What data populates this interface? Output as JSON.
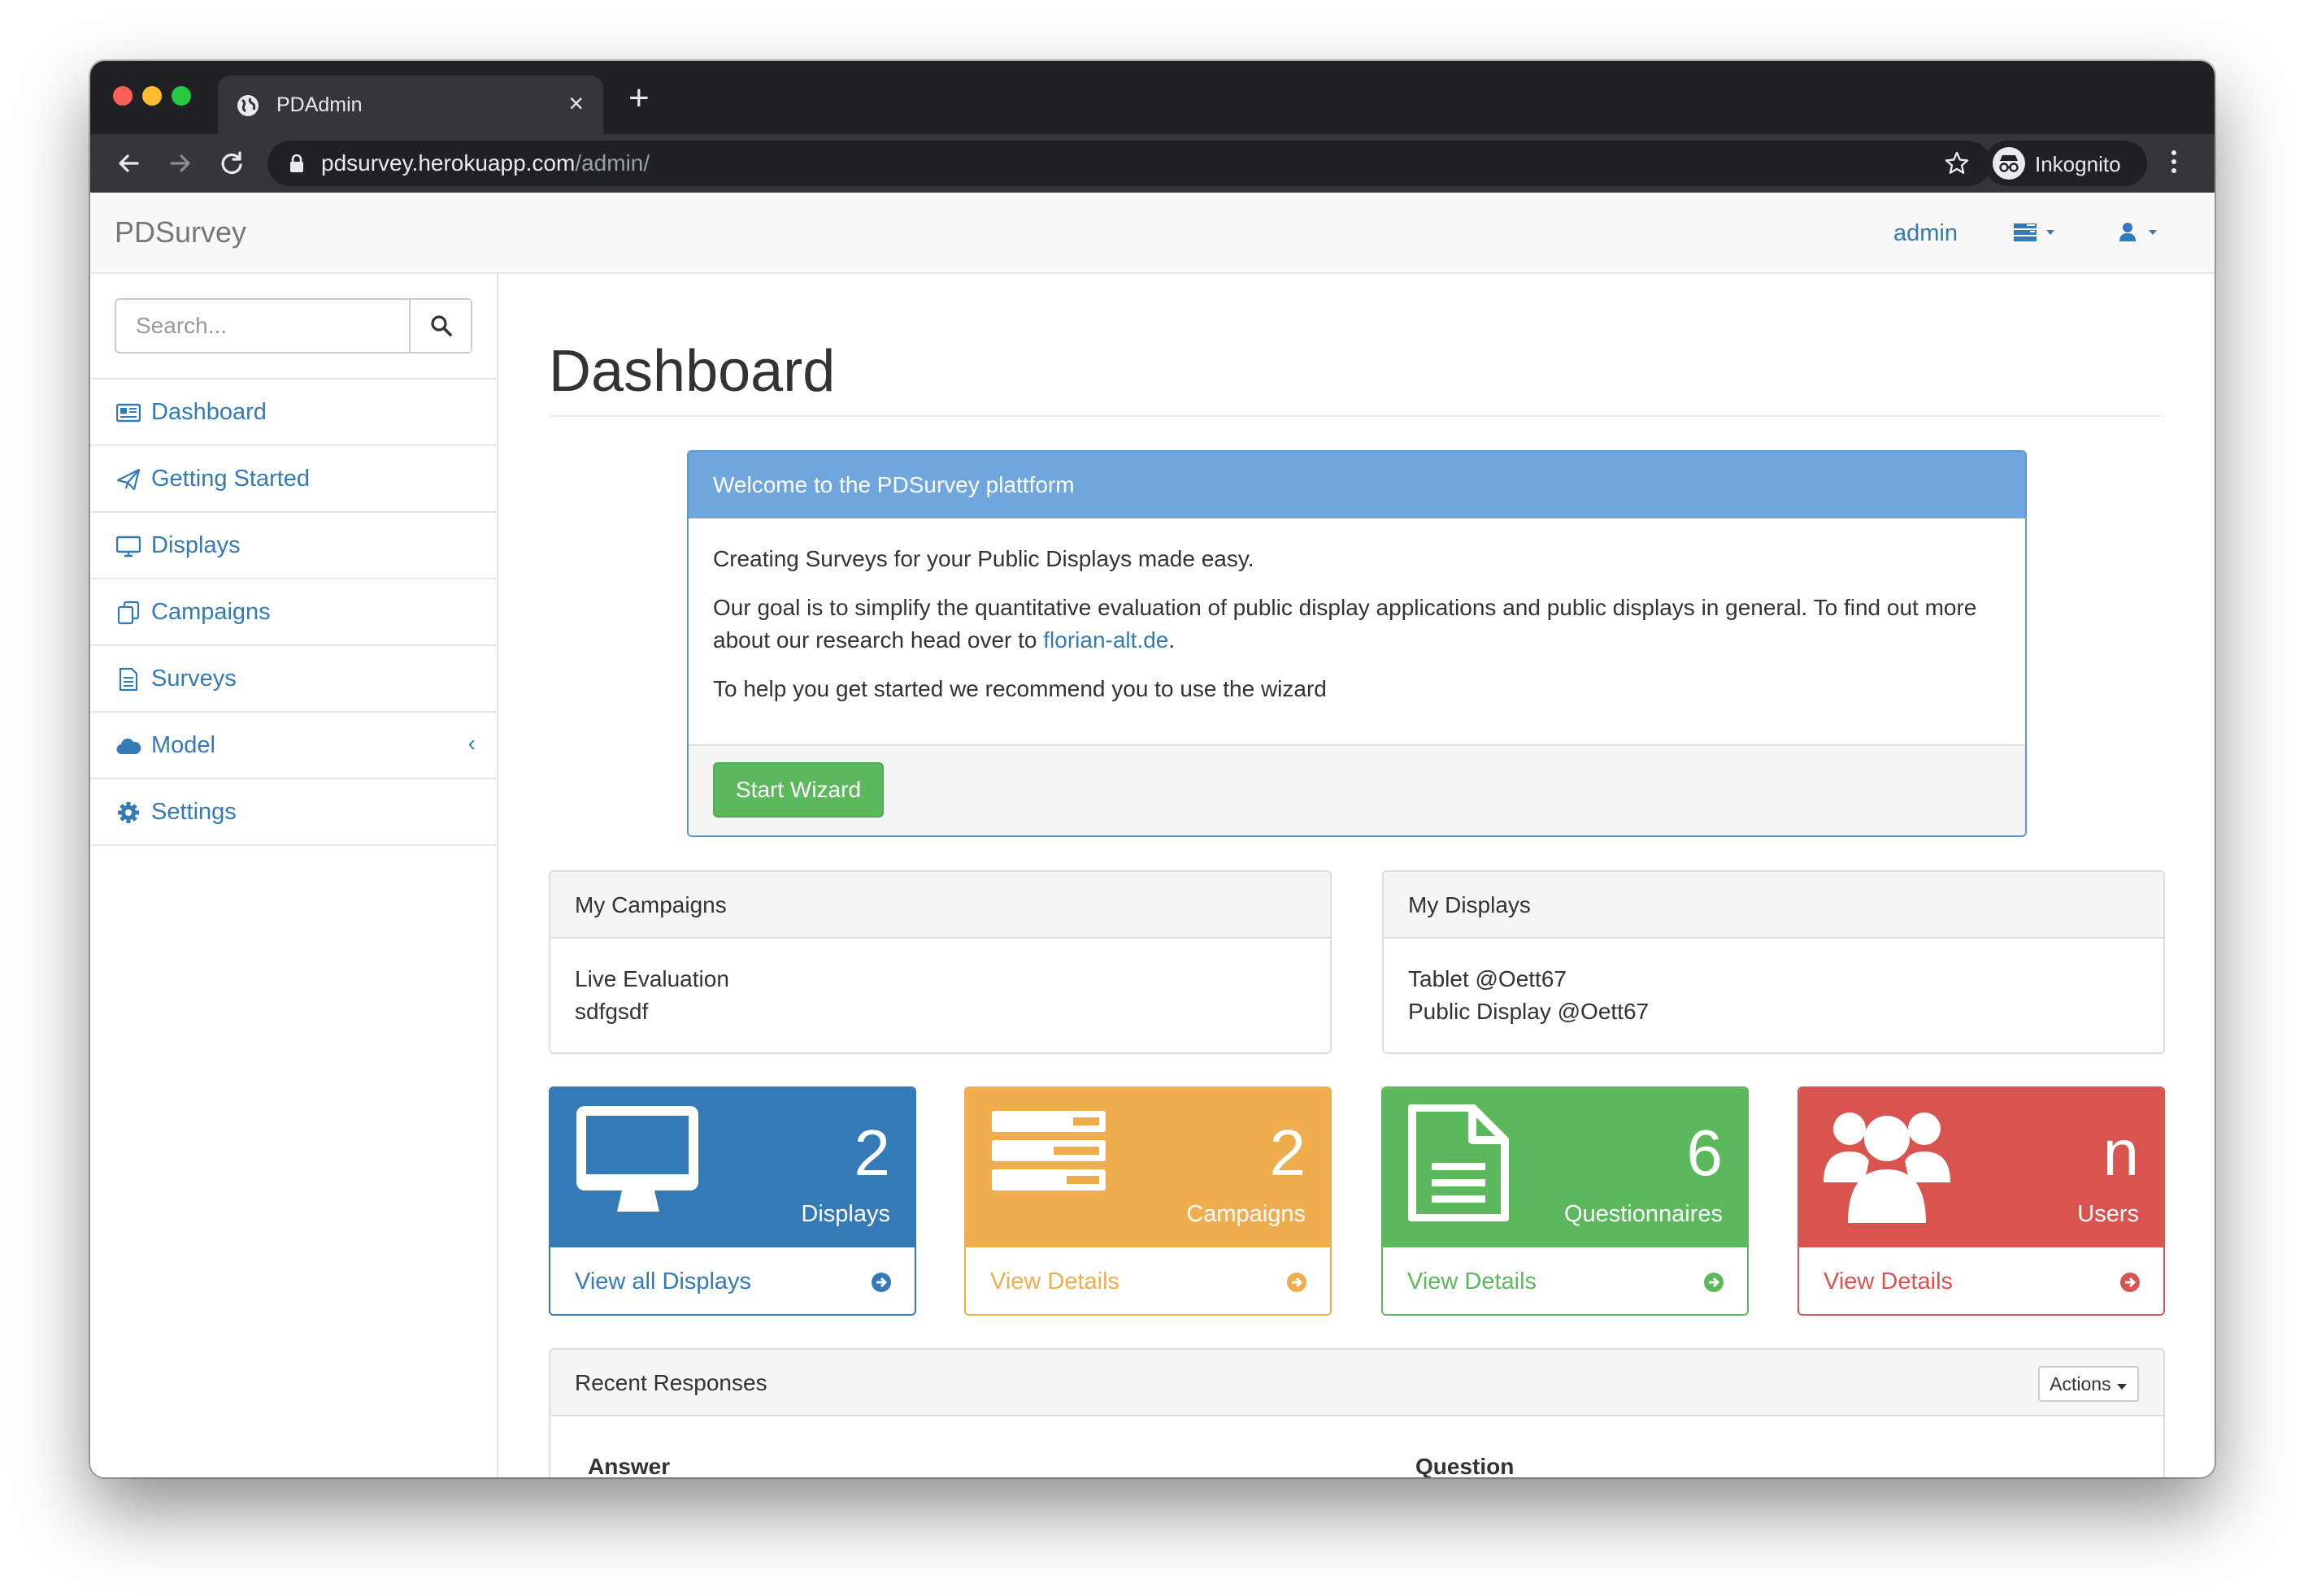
{
  "browser": {
    "tab_title": "PDAdmin",
    "url_host": "pdsurvey.herokuapp.com",
    "url_path": "/admin/",
    "profile_label": "Inkognito"
  },
  "navbar": {
    "brand": "PDSurvey",
    "user_link": "admin"
  },
  "sidebar": {
    "search_placeholder": "Search...",
    "items": [
      {
        "label": "Dashboard",
        "icon": "dashboard-icon"
      },
      {
        "label": "Getting Started",
        "icon": "paper-plane-icon"
      },
      {
        "label": "Displays",
        "icon": "monitor-icon"
      },
      {
        "label": "Campaigns",
        "icon": "copy-icon"
      },
      {
        "label": "Surveys",
        "icon": "file-text-icon"
      },
      {
        "label": "Model",
        "icon": "cloud-icon",
        "chevron": "‹"
      },
      {
        "label": "Settings",
        "icon": "gear-icon"
      }
    ]
  },
  "main": {
    "title": "Dashboard",
    "welcome": {
      "heading": "Welcome to the PDSurvey plattform",
      "line1": "Creating Surveys for your Public Displays made easy.",
      "line2_before": "Our goal is to simplify the quantitative evaluation of public display applications and public displays in general. To find out more about our research head over to ",
      "line2_link": "florian-alt.de",
      "line2_after": ".",
      "line3": "To help you get started we recommend you to use the wizard",
      "button": "Start Wizard"
    },
    "campaigns_panel": {
      "heading": "My Campaigns",
      "items": [
        "Live Evaluation",
        "sdfgsdf"
      ]
    },
    "displays_panel": {
      "heading": "My Displays",
      "items": [
        "Tablet @Oett67",
        "Public Display @Oett67"
      ]
    },
    "stats": [
      {
        "value": "2",
        "label": "Displays",
        "link": "View all Displays",
        "color": "#337ab7",
        "icon": "desktop-icon"
      },
      {
        "value": "2",
        "label": "Campaigns",
        "link": "View Details",
        "color": "#f0ad4e",
        "icon": "tasks-icon"
      },
      {
        "value": "6",
        "label": "Questionnaires",
        "link": "View Details",
        "color": "#5cb85c",
        "icon": "document-icon"
      },
      {
        "value": "n",
        "label": "Users",
        "link": "View Details",
        "color": "#d9534f",
        "icon": "users-icon"
      }
    ],
    "recent": {
      "heading": "Recent Responses",
      "actions_label": "Actions",
      "columns": [
        "Answer",
        "Question"
      ]
    }
  }
}
